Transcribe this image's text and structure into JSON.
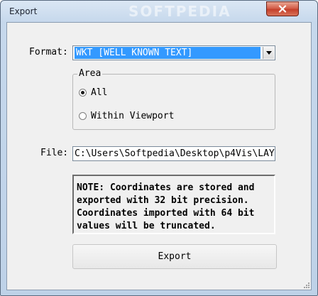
{
  "window": {
    "title": "Export",
    "watermark": "SOFTPEDIA"
  },
  "format": {
    "label": "Format:",
    "selected": "WKT [WELL KNOWN TEXT]"
  },
  "area": {
    "title": "Area",
    "options": [
      {
        "label": "All",
        "checked": true
      },
      {
        "label": "Within Viewport",
        "checked": false
      }
    ]
  },
  "file": {
    "label": "File:",
    "value": "C:\\Users\\Softpedia\\Desktop\\p4Vis\\LAY"
  },
  "note": {
    "lines": [
      "NOTE:  Coordinates are stored and",
      "exported with 32 bit precision.",
      "Coordinates imported with 64 bit",
      "values will be truncated."
    ]
  },
  "actions": {
    "export_label": "Export"
  },
  "icons": {
    "close": "close-icon",
    "dropdown": "dropdown-arrow-icon",
    "resize": "resize-grip-icon"
  }
}
